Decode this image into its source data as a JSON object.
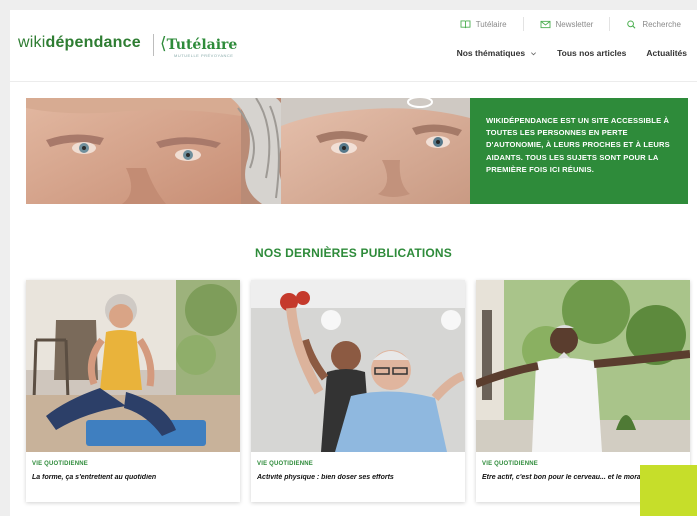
{
  "header": {
    "logo_wiki": "wiki",
    "logo_dependance": "dépendance",
    "partner_mark": "⟨",
    "partner_name": "Tutélaire",
    "partner_sub": "MUTUELLE PRÉVOYANCE",
    "utility": [
      {
        "label": "Tutélaire",
        "icon": "book-icon"
      },
      {
        "label": "Newsletter",
        "icon": "mail-icon"
      },
      {
        "label": "Recherche",
        "icon": "search-icon"
      }
    ],
    "nav": [
      {
        "label": "Nos thématiques",
        "dropdown": true
      },
      {
        "label": "Tous nos articles"
      },
      {
        "label": "Actualités"
      }
    ]
  },
  "hero": {
    "text": "WIKIDÉPENDANCE EST UN SITE ACCESSIBLE À TOUTES LES PERSONNES EN PERTE D'AUTONOMIE, À LEURS PROCHES ET À LEURS AIDANTS. TOUS LES SUJETS SONT POUR LA PREMIÈRE FOIS ICI RÉUNIS."
  },
  "section": {
    "title": "NOS DERNIÈRES PUBLICATIONS"
  },
  "cards": [
    {
      "category": "VIE QUOTIDIENNE",
      "title": "La forme, ça s'entretient au quotidien"
    },
    {
      "category": "VIE QUOTIDIENNE",
      "title": "Activité physique : bien doser ses efforts"
    },
    {
      "category": "VIE QUOTIDIENNE",
      "title": "Être actif, c'est bon pour le cerveau... et le moral"
    }
  ],
  "colors": {
    "brand_green": "#2e8b3a",
    "accent_lime": "#c6de2a"
  }
}
